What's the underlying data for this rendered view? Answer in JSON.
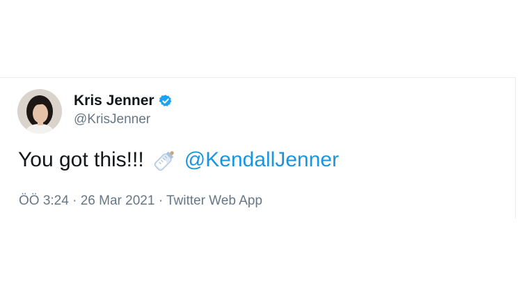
{
  "tweet": {
    "author": {
      "display_name": "Kris Jenner",
      "handle": "@KrisJenner",
      "verified": true,
      "avatar_icon": "profile-photo"
    },
    "text": "You got this!!!",
    "emoji_icon": "baby-bottle-icon",
    "mention": "@KendallJenner",
    "meta": {
      "time": "ÖÖ 3:24",
      "separator": "·",
      "date": "26 Mar 2021",
      "source": "Twitter Web App"
    }
  },
  "colors": {
    "text": "#14171a",
    "secondary": "#657786",
    "link": "#1b95e0",
    "verified": "#1da1f2"
  }
}
